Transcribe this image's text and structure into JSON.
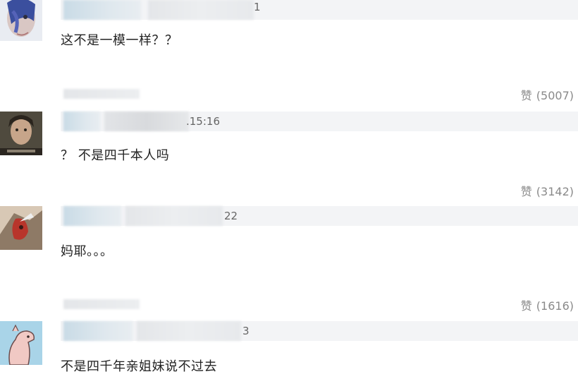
{
  "comments": [
    {
      "timestamp_fragment": "1",
      "text": "这不是一模一样？？",
      "like_label": "赞",
      "like_count": "(5007)"
    },
    {
      "timestamp_fragment": ".15:16",
      "text": "？ 不是四千本人吗",
      "like_label": "赞",
      "like_count": "(3142)"
    },
    {
      "timestamp_fragment": "22",
      "text": "妈耶。。。",
      "like_label": "赞",
      "like_count": "(1616)"
    },
    {
      "timestamp_fragment": "3",
      "text": "不是四千年亲姐妹说不过去"
    }
  ],
  "colors": {
    "header_bar": "#f3f4f6",
    "comment_text": "#222222",
    "like_text": "#8a8a8a"
  }
}
